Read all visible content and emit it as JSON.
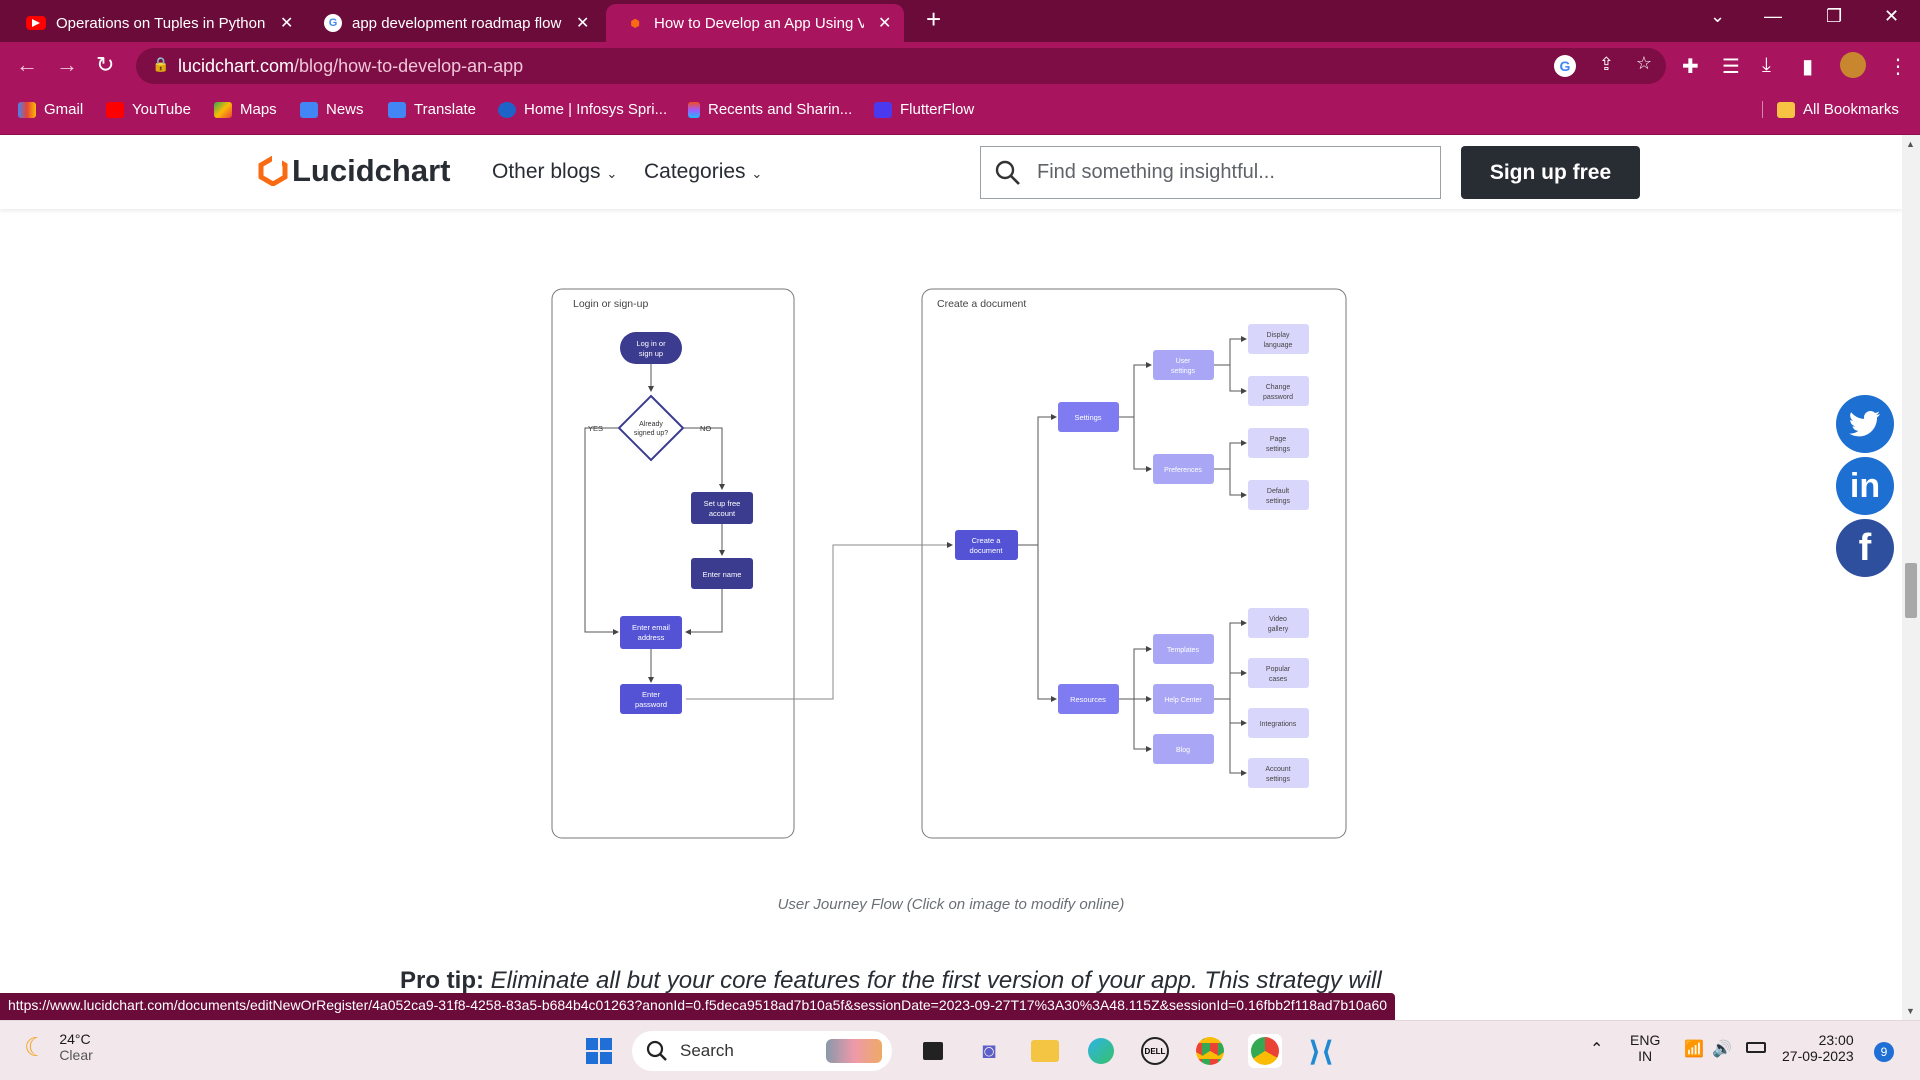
{
  "browser": {
    "tabs": [
      {
        "title": "Operations on Tuples in Python",
        "icon": "youtube-icon",
        "active": false
      },
      {
        "title": "app development roadmap flow",
        "icon": "google-icon",
        "active": false
      },
      {
        "title": "How to Develop an App Using V",
        "icon": "lucidchart-icon",
        "active": true
      }
    ],
    "new_tab_label": "+",
    "url_host": "lucidchart.com",
    "url_path": "/blog/how-to-develop-an-app",
    "bookmarks": [
      {
        "label": "Gmail",
        "icon": "gmail-icon"
      },
      {
        "label": "YouTube",
        "icon": "youtube-icon"
      },
      {
        "label": "Maps",
        "icon": "maps-icon"
      },
      {
        "label": "News",
        "icon": "news-icon"
      },
      {
        "label": "Translate",
        "icon": "translate-icon"
      },
      {
        "label": "Home | Infosys Spri...",
        "icon": "infosys-icon"
      },
      {
        "label": "Recents and Sharin...",
        "icon": "figma-icon"
      },
      {
        "label": "FlutterFlow",
        "icon": "flutterflow-icon"
      }
    ],
    "all_bookmarks_label": "All Bookmarks",
    "status_url": "https://www.lucidchart.com/documents/editNewOrRegister/4a052ca9-31f8-4258-83a5-b684b4c01263?anonId=0.f5deca9518ad7b10a5f&sessionDate=2023-09-27T17%3A30%3A48.115Z&sessionId=0.16fbb2f118ad7b10a60"
  },
  "site": {
    "logo_text": "Lucidchart",
    "nav": [
      "Other blogs",
      "Categories"
    ],
    "search_placeholder": "Find something insightful...",
    "signup_label": "Sign up free"
  },
  "diagram": {
    "login_panel_title": "Login or sign-up",
    "create_panel_title": "Create a document",
    "login_nodes": {
      "start": [
        "Log in or",
        "sign up"
      ],
      "decision": [
        "Already",
        "signed up?"
      ],
      "yes": "YES",
      "no": "NO",
      "setup": [
        "Set up free",
        "account"
      ],
      "name": [
        "Enter name"
      ],
      "email": [
        "Enter email",
        "address"
      ],
      "password": [
        "Enter",
        "password"
      ]
    },
    "create_nodes": {
      "create": [
        "Create a",
        "document"
      ],
      "settings": [
        "Settings"
      ],
      "resources": [
        "Resources"
      ],
      "user_settings": [
        "User",
        "settings"
      ],
      "preferences": [
        "Preferences"
      ],
      "templates": [
        "Templates"
      ],
      "help_center": [
        "Help Center"
      ],
      "blog": [
        "Blog"
      ],
      "display_language": [
        "Display",
        "language"
      ],
      "change_password": [
        "Change",
        "password"
      ],
      "page_settings": [
        "Page",
        "settings"
      ],
      "default_settings": [
        "Default",
        "settings"
      ],
      "video_gallery": [
        "Video",
        "gallery"
      ],
      "popular_cases": [
        "Popular",
        "cases"
      ],
      "integrations": [
        "Integrations"
      ],
      "account_settings": [
        "Account",
        "settings"
      ]
    },
    "colors": {
      "dark_node": "#3b3b8f",
      "mid_node": "#5453d6",
      "light_node": "#a9a7f5",
      "pale_node": "#d8d7fb"
    }
  },
  "caption": "User Journey Flow (Click on image to modify online)",
  "protip": {
    "label": "Pro tip:",
    "text": "Eliminate all but your core features for the first version of your app. This strategy will"
  },
  "social": [
    "twitter-icon",
    "linkedin-icon",
    "facebook-icon"
  ],
  "taskbar": {
    "weather_temp": "24°C",
    "weather_desc": "Clear",
    "search_label": "Search",
    "lang_top": "ENG",
    "lang_bottom": "IN",
    "time": "23:00",
    "date": "27-09-2023",
    "notification_count": "9"
  }
}
